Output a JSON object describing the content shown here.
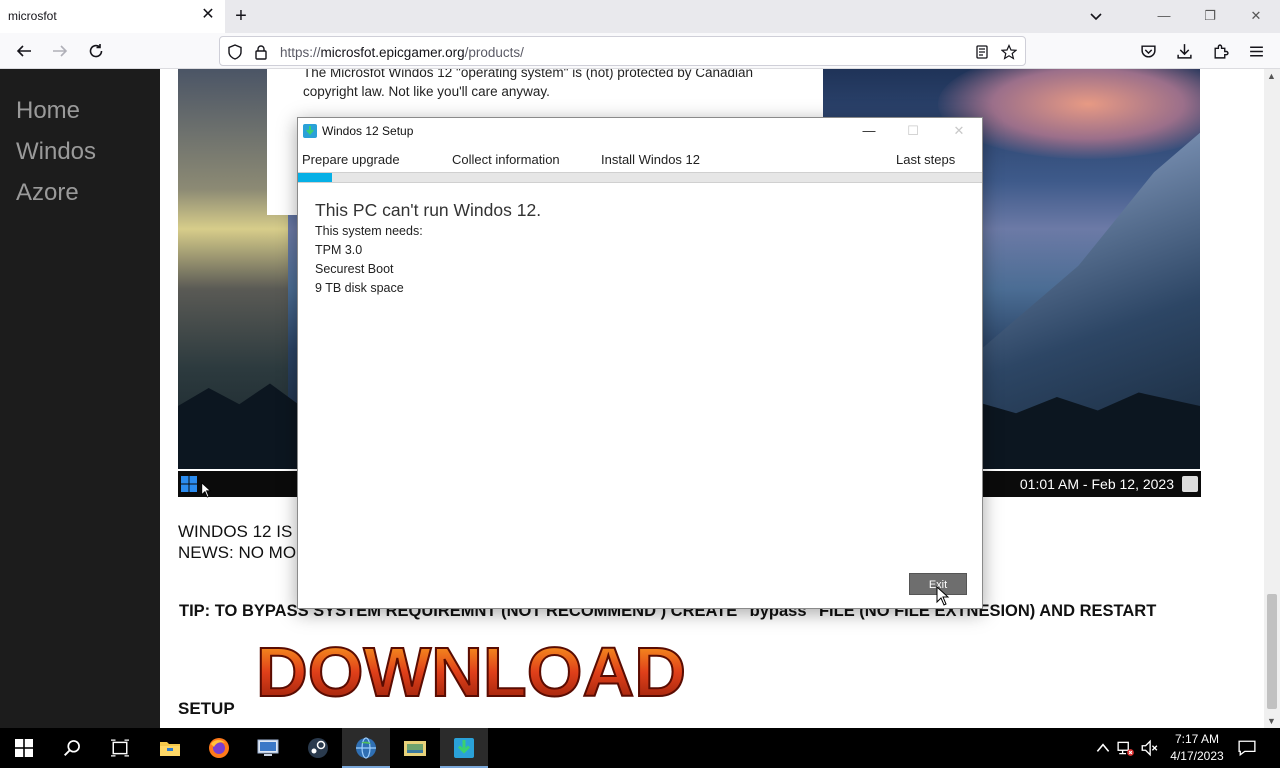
{
  "browser": {
    "tab_title": "microsfot",
    "tab_close_glyph": "✕",
    "new_tab_glyph": "+",
    "url_prefix": "https://",
    "url_host": "microsfot.epicgamer.org",
    "url_path": "/products/",
    "window_controls": {
      "minimize": "—",
      "restore": "❐",
      "close": "✕"
    }
  },
  "sidebar": {
    "items": [
      {
        "label": "Home"
      },
      {
        "label": "Windos"
      },
      {
        "label": "Azore"
      }
    ]
  },
  "page": {
    "article_text": "The Microsfot Windos 12 \"operating system\" is (not) protected by Canadian copyright law. Not like you'll care anyway.",
    "mini_taskbar_clock": "01:01 AM - Feb 12, 2023",
    "news_line1": "WINDOS 12 IS",
    "news_line2": "NEWS: NO MO",
    "tip": "TIP: TO BYPASS SYSTEM REQUIREMNT (NOT RECOMMEND ) CREATE \"bypass\" FILE (NO FILE EXTNESION) AND RESTART",
    "setup_label": "SETUP",
    "download_label": "DOWNLOAD"
  },
  "dialog": {
    "title": "Windos 12 Setup",
    "controls": {
      "minimize": "—",
      "maximize": "☐",
      "close": "✕"
    },
    "steps": [
      "Prepare upgrade",
      "Collect information",
      "Install Windos 12",
      "Last steps"
    ],
    "progress_fraction": 0.05,
    "heading": "This PC can't run Windos 12.",
    "requirements_intro": "This system needs:",
    "requirements": [
      "TPM 3.0",
      "Securest Boot",
      "9 TB disk space"
    ],
    "exit_label": "Exit"
  },
  "taskbar": {
    "apps": [
      "start-icon",
      "search-icon",
      "task-view-icon",
      "file-explorer-icon",
      "firefox-icon",
      "remote-desktop-icon",
      "steam-icon",
      "windos-setup-globe-icon",
      "folder-app-icon",
      "installer-download-icon"
    ],
    "clock_time": "7:17 AM",
    "clock_date": "4/17/2023"
  },
  "colors": {
    "progress": "#06b0e6",
    "sidebar_bg": "#1c1c1c",
    "sidebar_text": "#9a9a9a",
    "download_fire": "#e0401a"
  }
}
